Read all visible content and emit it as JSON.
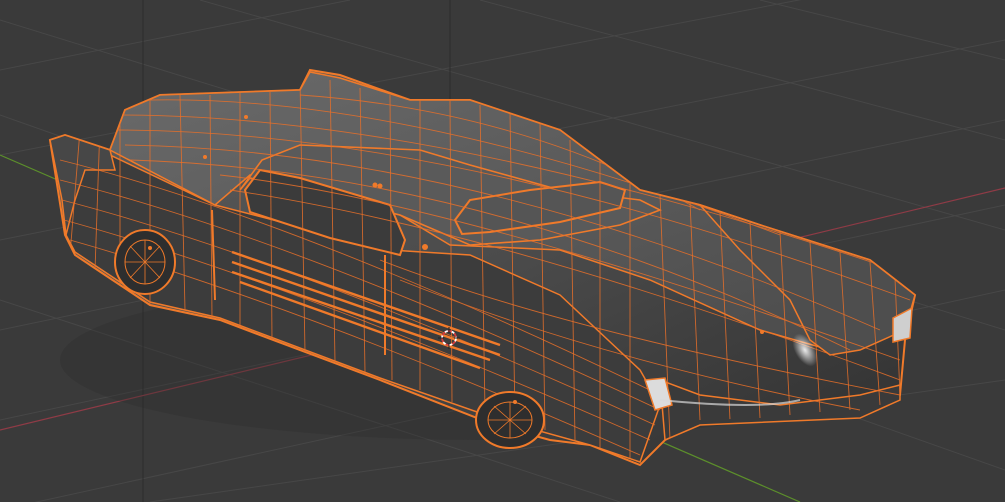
{
  "app": {
    "name": "",
    "view": "3D Viewport"
  },
  "viewport": {
    "background_color": "#3a3a3a",
    "grid_color": "#4a4a4a",
    "axis_x_color": "#8f3b46",
    "axis_y_color": "#5c8f2b",
    "selection_color": "#f07a2a",
    "object": "car-mesh",
    "mode": "edit-mode-wireframe",
    "selected": true
  }
}
